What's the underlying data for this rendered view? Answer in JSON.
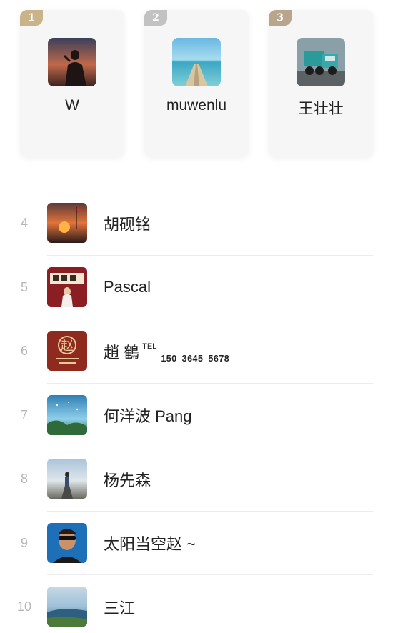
{
  "top_three": [
    {
      "rank": "1",
      "name": "W",
      "badge_color": "#c9b48a"
    },
    {
      "rank": "2",
      "name": "muwenlu",
      "badge_color": "#c2c2c2"
    },
    {
      "rank": "3",
      "name": "王壮壮",
      "badge_color": "#b9a58c"
    }
  ],
  "list": [
    {
      "rank": "4",
      "name": "胡砚铭"
    },
    {
      "rank": "5",
      "name": "Pascal"
    },
    {
      "rank": "6",
      "name": "趙 鶴",
      "tel_label": "TEL",
      "tel_number": "150 3645 5678"
    },
    {
      "rank": "7",
      "name": "何洋波 Pang"
    },
    {
      "rank": "8",
      "name": "杨先森"
    },
    {
      "rank": "9",
      "name": "太阳当空赵 ~"
    },
    {
      "rank": "10",
      "name": "三江"
    }
  ],
  "avatar_logo_text": "赵"
}
